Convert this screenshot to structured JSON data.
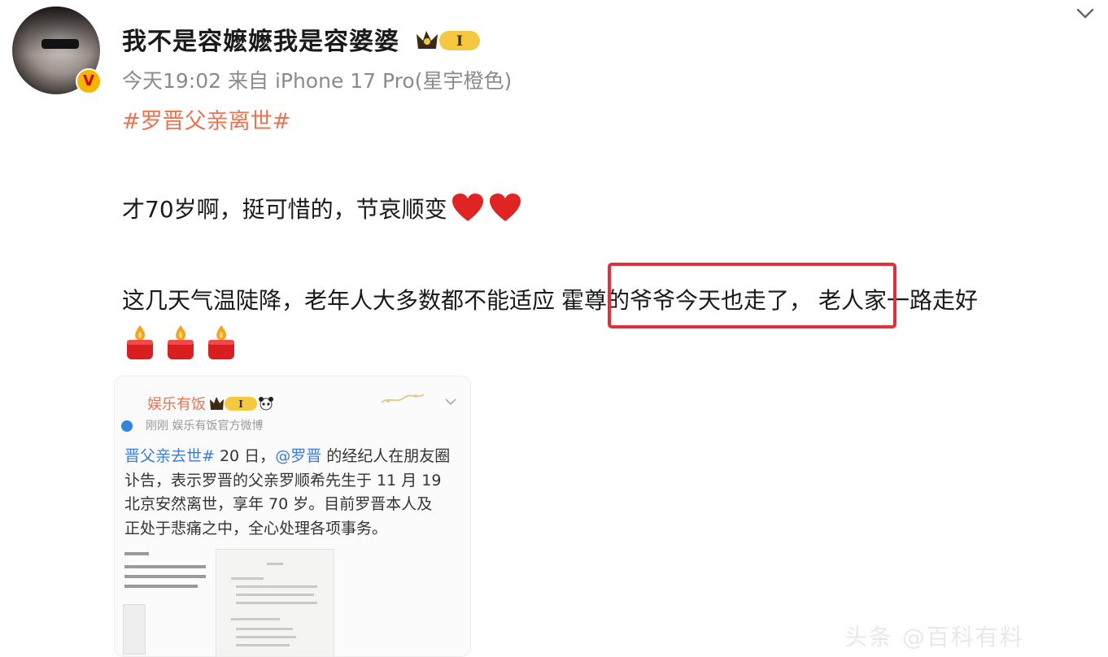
{
  "post": {
    "username": "我不是容嬷嬷我是容婆婆",
    "level_badge_text": "I",
    "meta": "今天19:02 来自 iPhone 17 Pro(星宇橙色)",
    "hashtag": "#罗晋父亲离世#",
    "line1": "才70岁啊，挺可惜的，节哀顺变",
    "line2_before": "这几天气温陡降，老年人大多数都不能适应",
    "line2_highlight": "霍尊的爷爷今天也走了，",
    "line2_after": "老人家一路走好",
    "avatar_badge": "V",
    "highlight_color": "#e0303a",
    "hashtag_color": "#eb7350"
  },
  "embed": {
    "name": "娱乐有饭",
    "badge_text": "I",
    "sub": "刚刚  娱乐有饭官方微博",
    "text_lines": [
      {
        "pre": "晋父亲去世#",
        "mid": " 20 日，",
        "blue": "@罗晋",
        "post": " 的经纪人在朋友圈"
      },
      {
        "pre": "讣告，表示罗晋的父亲罗顺希先生于 11 月 19",
        "mid": "",
        "blue": "",
        "post": ""
      },
      {
        "pre": "北京安然离世，享年 70 岁。目前罗晋本人及",
        "mid": "",
        "blue": "",
        "post": ""
      },
      {
        "pre": "正处于悲痛之中，全心处理各项事务。",
        "mid": "",
        "blue": "",
        "post": ""
      }
    ],
    "link_color": "#3c7bd6"
  },
  "watermark": "头条 @百科有料"
}
